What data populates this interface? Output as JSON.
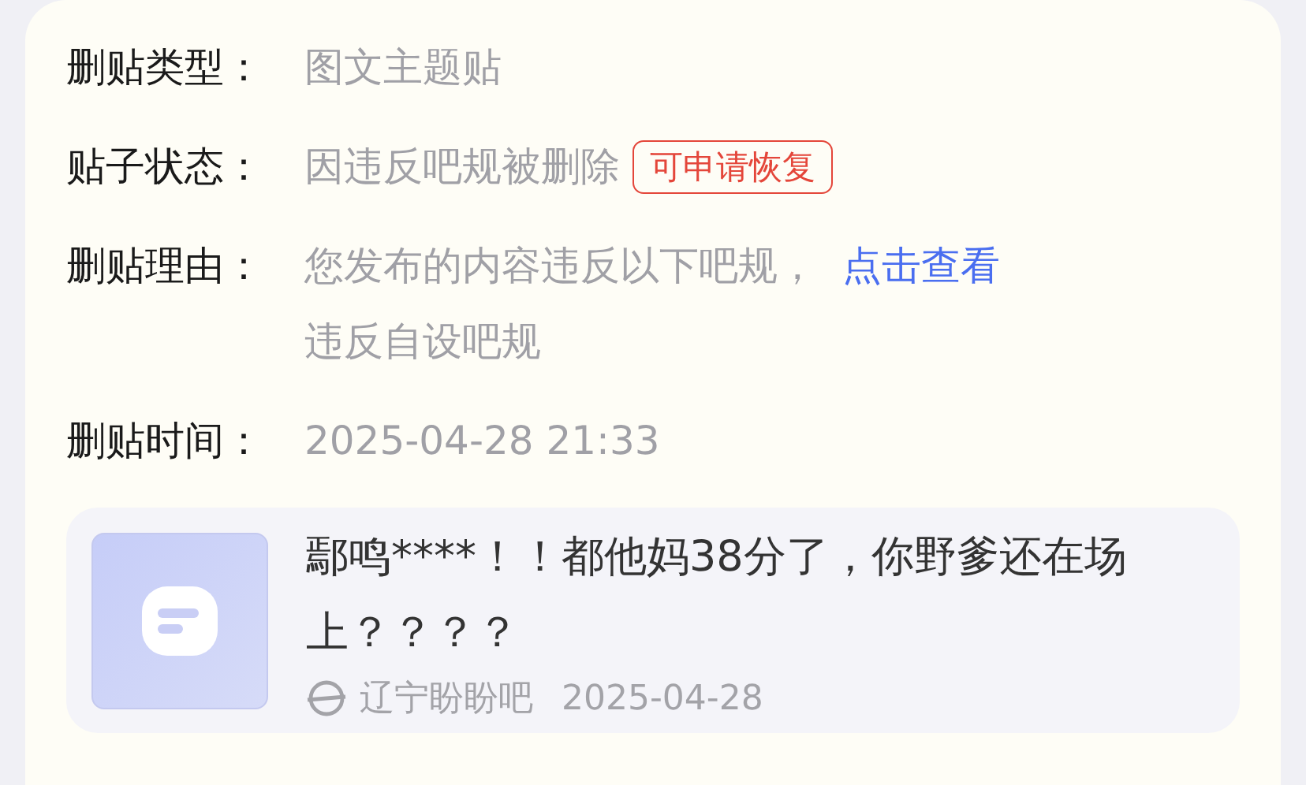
{
  "fields": [
    {
      "label": "删贴类型：",
      "value": "图文主题贴"
    },
    {
      "label": "贴子状态：",
      "value": "因违反吧规被删除",
      "badge": "可申请恢复"
    },
    {
      "label": "删贴理由：",
      "value": "您发布的内容违反以下吧规，",
      "link": "点击查看",
      "extra": "违反自设吧规"
    },
    {
      "label": "删贴时间：",
      "value": "2025-04-28 21:33"
    }
  ],
  "post": {
    "title": "鄢鸣****！！都他妈38分了，你野爹还在场上？？？？",
    "forum": "辽宁盼盼吧",
    "date": "2025-04-28"
  }
}
